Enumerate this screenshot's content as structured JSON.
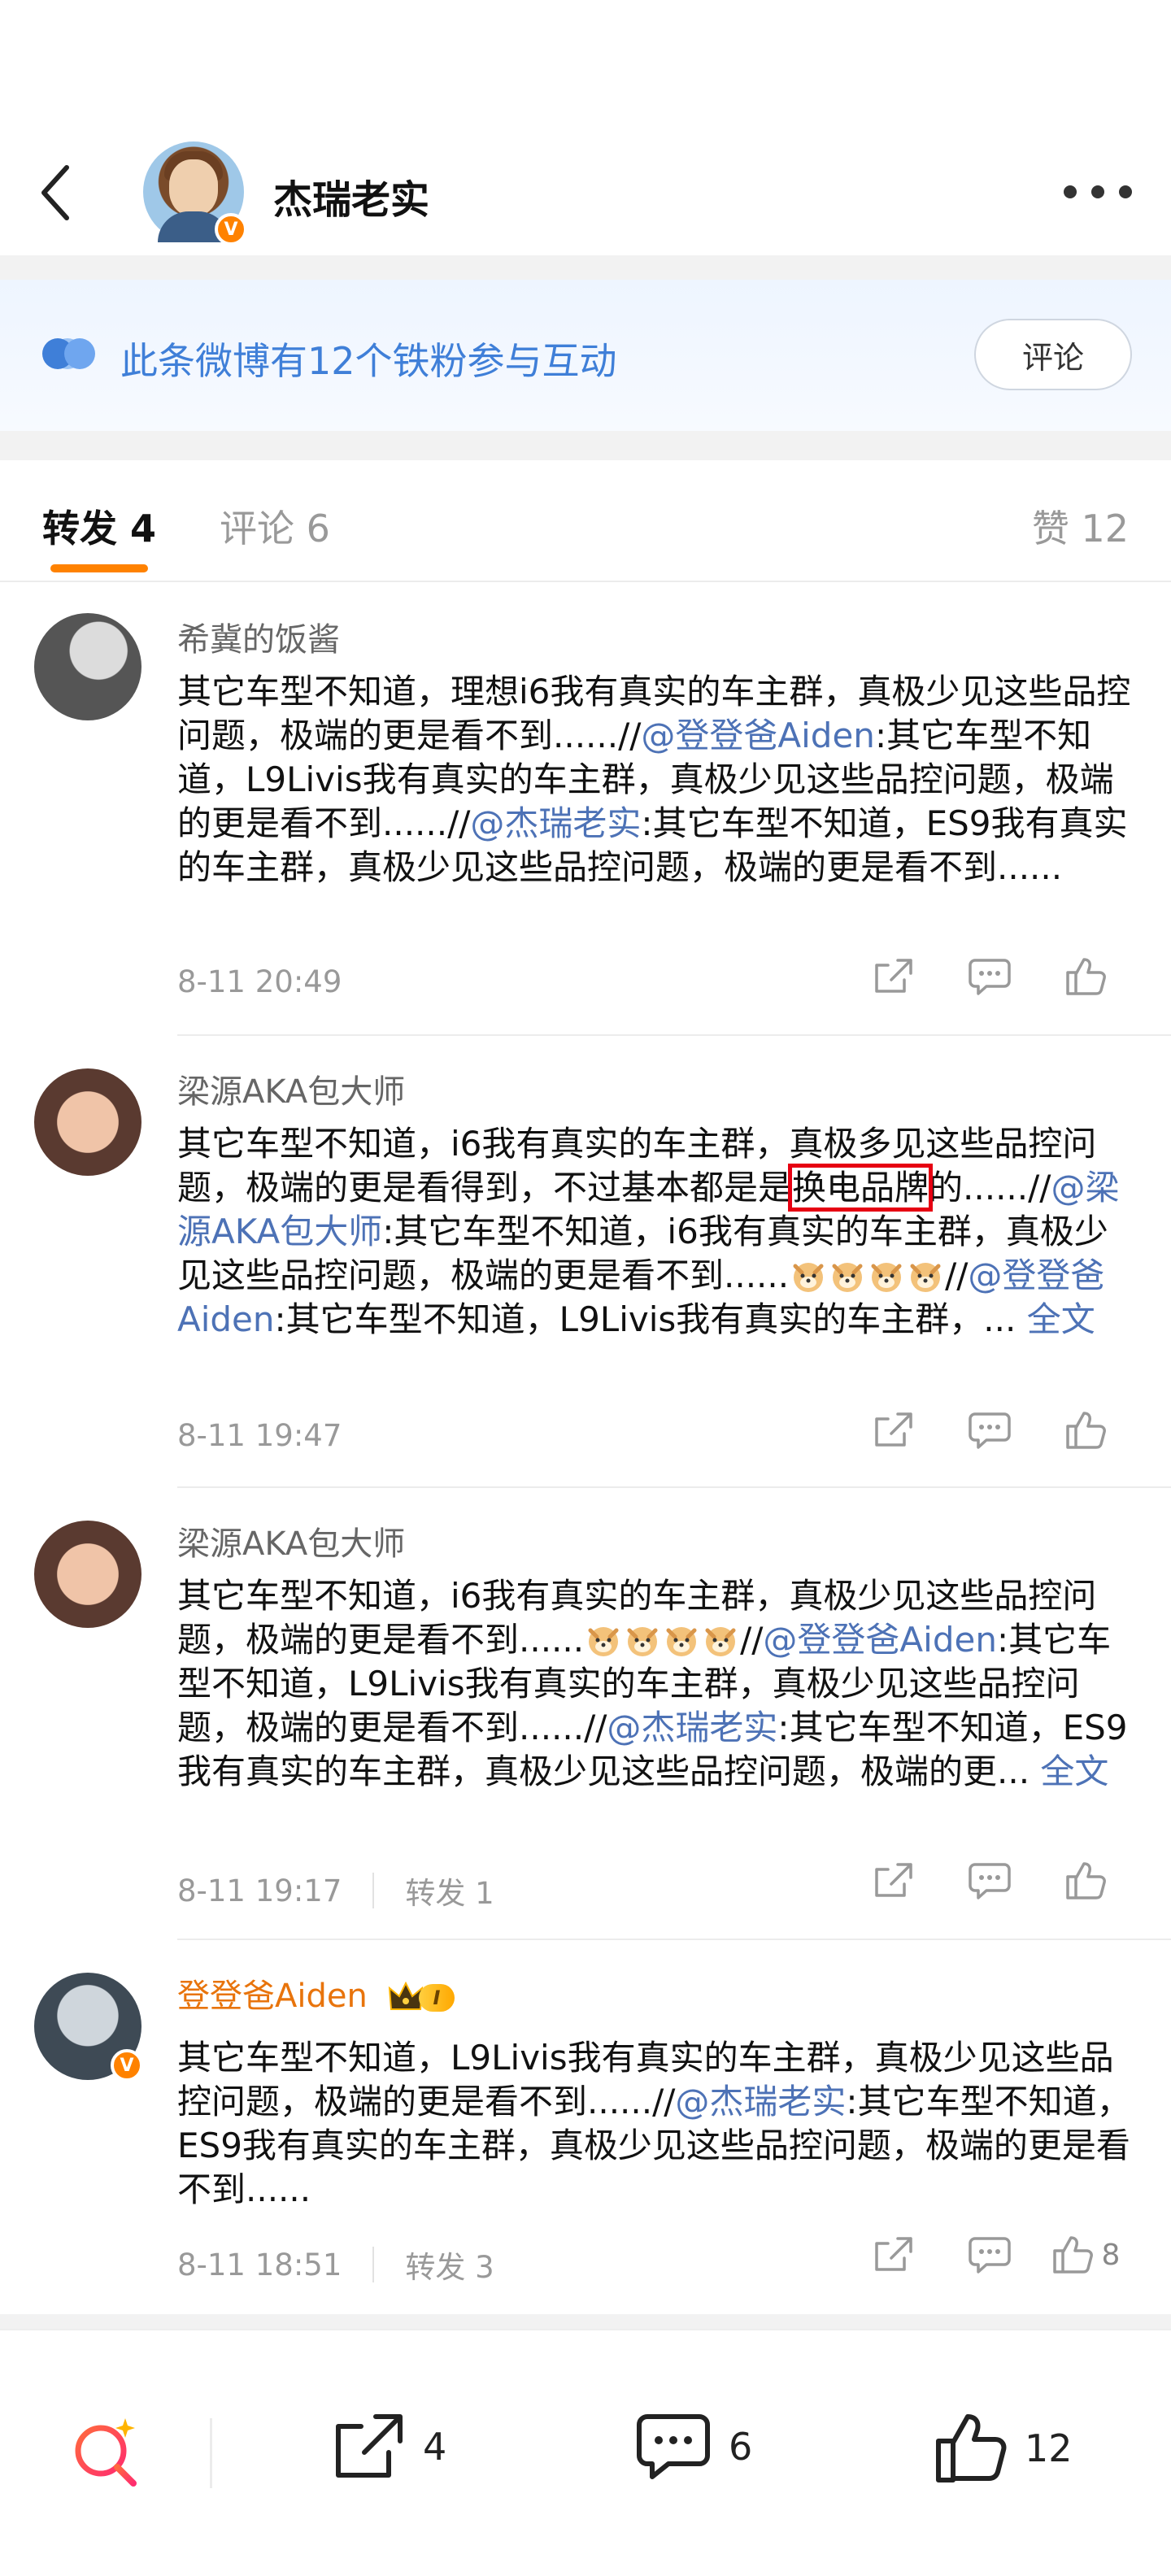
{
  "header": {
    "title": "杰瑞老实",
    "badge_v": "V"
  },
  "banner": {
    "text": "此条微博有12个铁粉参与互动",
    "button_label": "评论"
  },
  "tabs": [
    {
      "label": "转发 4",
      "active": true
    },
    {
      "label": "评论 6",
      "active": false
    },
    {
      "label": "赞 12",
      "active": false
    }
  ],
  "reposts": [
    {
      "username": "希冀的饭酱",
      "segments": [
        {
          "t": "其它车型不知道，理想i6我有真实的车主群，真极少见这些品控问题，极端的更是看不到......//"
        },
        {
          "t": "@登登爸Aiden",
          "mention": true
        },
        {
          "t": ":其它车型不知道，L9Livis我有真实的车主群，真极少见这些品控问题，极端的更是看不到......//"
        },
        {
          "t": "@杰瑞老实",
          "mention": true
        },
        {
          "t": ":其它车型不知道，ES9我有真实的车主群，真极少见这些品控问题，极端的更是看不到......"
        }
      ],
      "time": "8-11 20:49",
      "repost_count": "",
      "like_count": ""
    },
    {
      "username": "梁源AKA包大师",
      "segments": [
        {
          "t": "其它车型不知道，i6我有真实的车主群，真极多见这些品控问题，极端的更是看得到，不过基本都是是"
        },
        {
          "t": "换电品牌",
          "boxed": true
        },
        {
          "t": "的......//"
        },
        {
          "t": "@梁源AKA包大师",
          "mention": true
        },
        {
          "t": ":其它车型不知道，i6我有真实的车主群，真极少见这些品控问题，极端的更是看不到......"
        },
        {
          "emoji": 4
        },
        {
          "t": "//"
        },
        {
          "t": "@登登爸Aiden",
          "mention": true
        },
        {
          "t": ":其它车型不知道，L9Livis我有真实的车主群，... "
        },
        {
          "t": "全文",
          "fulltext": true
        }
      ],
      "time": "8-11 19:47",
      "repost_count": "",
      "like_count": ""
    },
    {
      "username": "梁源AKA包大师",
      "segments": [
        {
          "t": "其它车型不知道，i6我有真实的车主群，真极少见这些品控问题，极端的更是看不到......"
        },
        {
          "emoji": 4
        },
        {
          "t": "//"
        },
        {
          "t": "@登登爸Aiden",
          "mention": true
        },
        {
          "t": ":其它车型不知道，L9Livis我有真实的车主群，真极少见这些品控问题，极端的更是看不到......//"
        },
        {
          "t": "@杰瑞老实",
          "mention": true
        },
        {
          "t": ":其它车型不知道，ES9我有真实的车主群，真极少见这些品控问题，极端的更... "
        },
        {
          "t": "全文",
          "fulltext": true
        }
      ],
      "time": "8-11 19:17",
      "repost_count": "转发 1",
      "like_count": ""
    },
    {
      "username": "登登爸Aiden",
      "vip_level": "I",
      "segments": [
        {
          "t": "其它车型不知道，L9Livis我有真实的车主群，真极少见这些品控问题，极端的更是看不到......//"
        },
        {
          "t": "@杰瑞老实",
          "mention": true
        },
        {
          "t": ":其它车型不知道，ES9我有真实的车主群，真极少见这些品控问题，极端的更是看不到......"
        }
      ],
      "time": "8-11 18:51",
      "repost_count": "转发 3",
      "like_count": "8"
    }
  ],
  "bottom_bar": {
    "repost_count": "4",
    "comment_count": "6",
    "like_count": "12"
  },
  "colors": {
    "accent_orange": "#ff8200",
    "link_blue": "#4d72b6",
    "banner_blue": "#3f7fd8",
    "highlight_red": "#e60012"
  }
}
